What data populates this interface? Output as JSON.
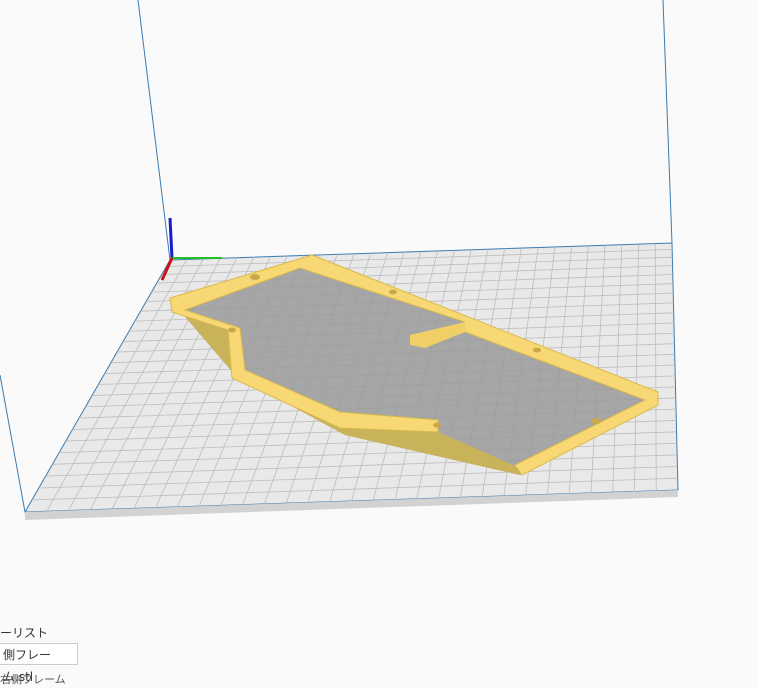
{
  "viewport": {
    "plate_color": "#e8e8e8",
    "grid_color": "#b8b8b8",
    "model_color": "#f5d76e"
  },
  "object_list": {
    "title": "ーリスト",
    "items": [
      "側フレーム.stl",
      "右側フレーム"
    ]
  }
}
